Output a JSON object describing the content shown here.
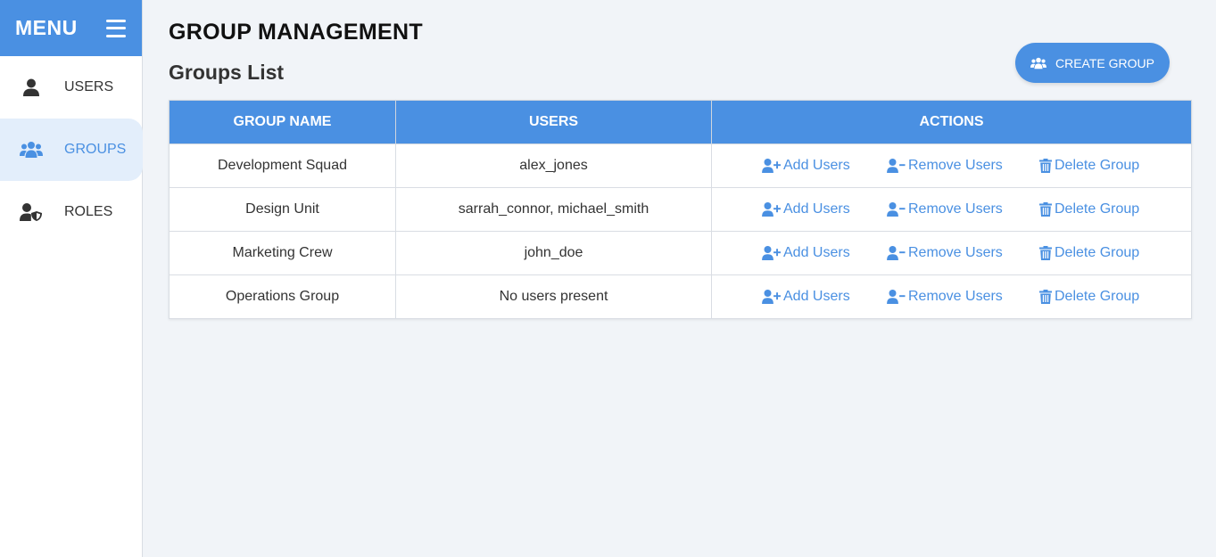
{
  "sidebar": {
    "title": "MENU",
    "items": [
      {
        "label": "USERS",
        "icon": "user-icon",
        "active": false
      },
      {
        "label": "GROUPS",
        "icon": "users-group-icon",
        "active": true
      },
      {
        "label": "ROLES",
        "icon": "user-shield-icon",
        "active": false
      }
    ]
  },
  "main": {
    "title": "GROUP MANAGEMENT",
    "section_title": "Groups List",
    "create_button": {
      "label": "CREATE GROUP",
      "icon": "users-group-icon"
    }
  },
  "table": {
    "headers": [
      "GROUP NAME",
      "USERS",
      "ACTIONS"
    ],
    "actions": {
      "add": {
        "label": "Add Users",
        "icon": "user-plus-icon"
      },
      "remove": {
        "label": "Remove Users",
        "icon": "user-minus-icon"
      },
      "delete": {
        "label": "Delete Group",
        "icon": "trash-icon"
      }
    },
    "rows": [
      {
        "name": "Development Squad",
        "users": "alex_jones"
      },
      {
        "name": "Design Unit",
        "users": "sarrah_connor, michael_smith"
      },
      {
        "name": "Marketing Crew",
        "users": "john_doe"
      },
      {
        "name": "Operations Group",
        "users": "No users present"
      }
    ]
  },
  "colors": {
    "accent": "#4a90e2",
    "background": "#f1f4f8",
    "active_nav_bg": "#e3eefb"
  }
}
